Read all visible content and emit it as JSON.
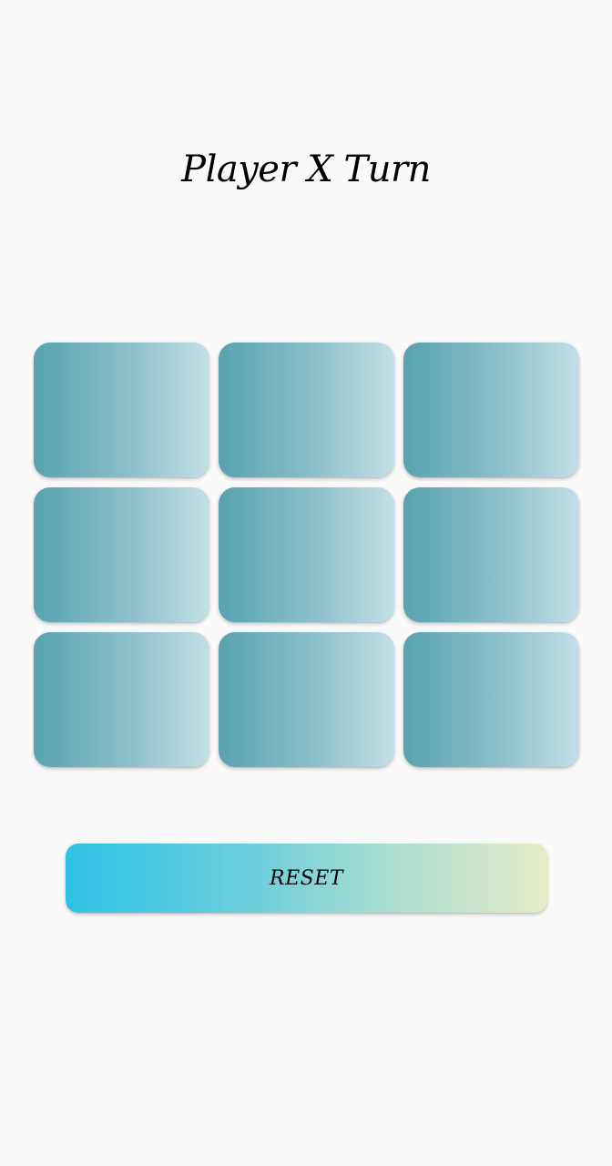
{
  "status": {
    "turn_text": "Player X Turn"
  },
  "board": {
    "cells": [
      "",
      "",
      "",
      "",
      "",
      "",
      "",
      "",
      ""
    ]
  },
  "controls": {
    "reset_label": "RESET"
  },
  "colors": {
    "background": "#fafafa",
    "cell_gradient_start": "#57a3af",
    "cell_gradient_end": "#c4dfe6",
    "reset_gradient_start": "#2ec2e6",
    "reset_gradient_end": "#e6ecc7",
    "text": "#000000"
  }
}
